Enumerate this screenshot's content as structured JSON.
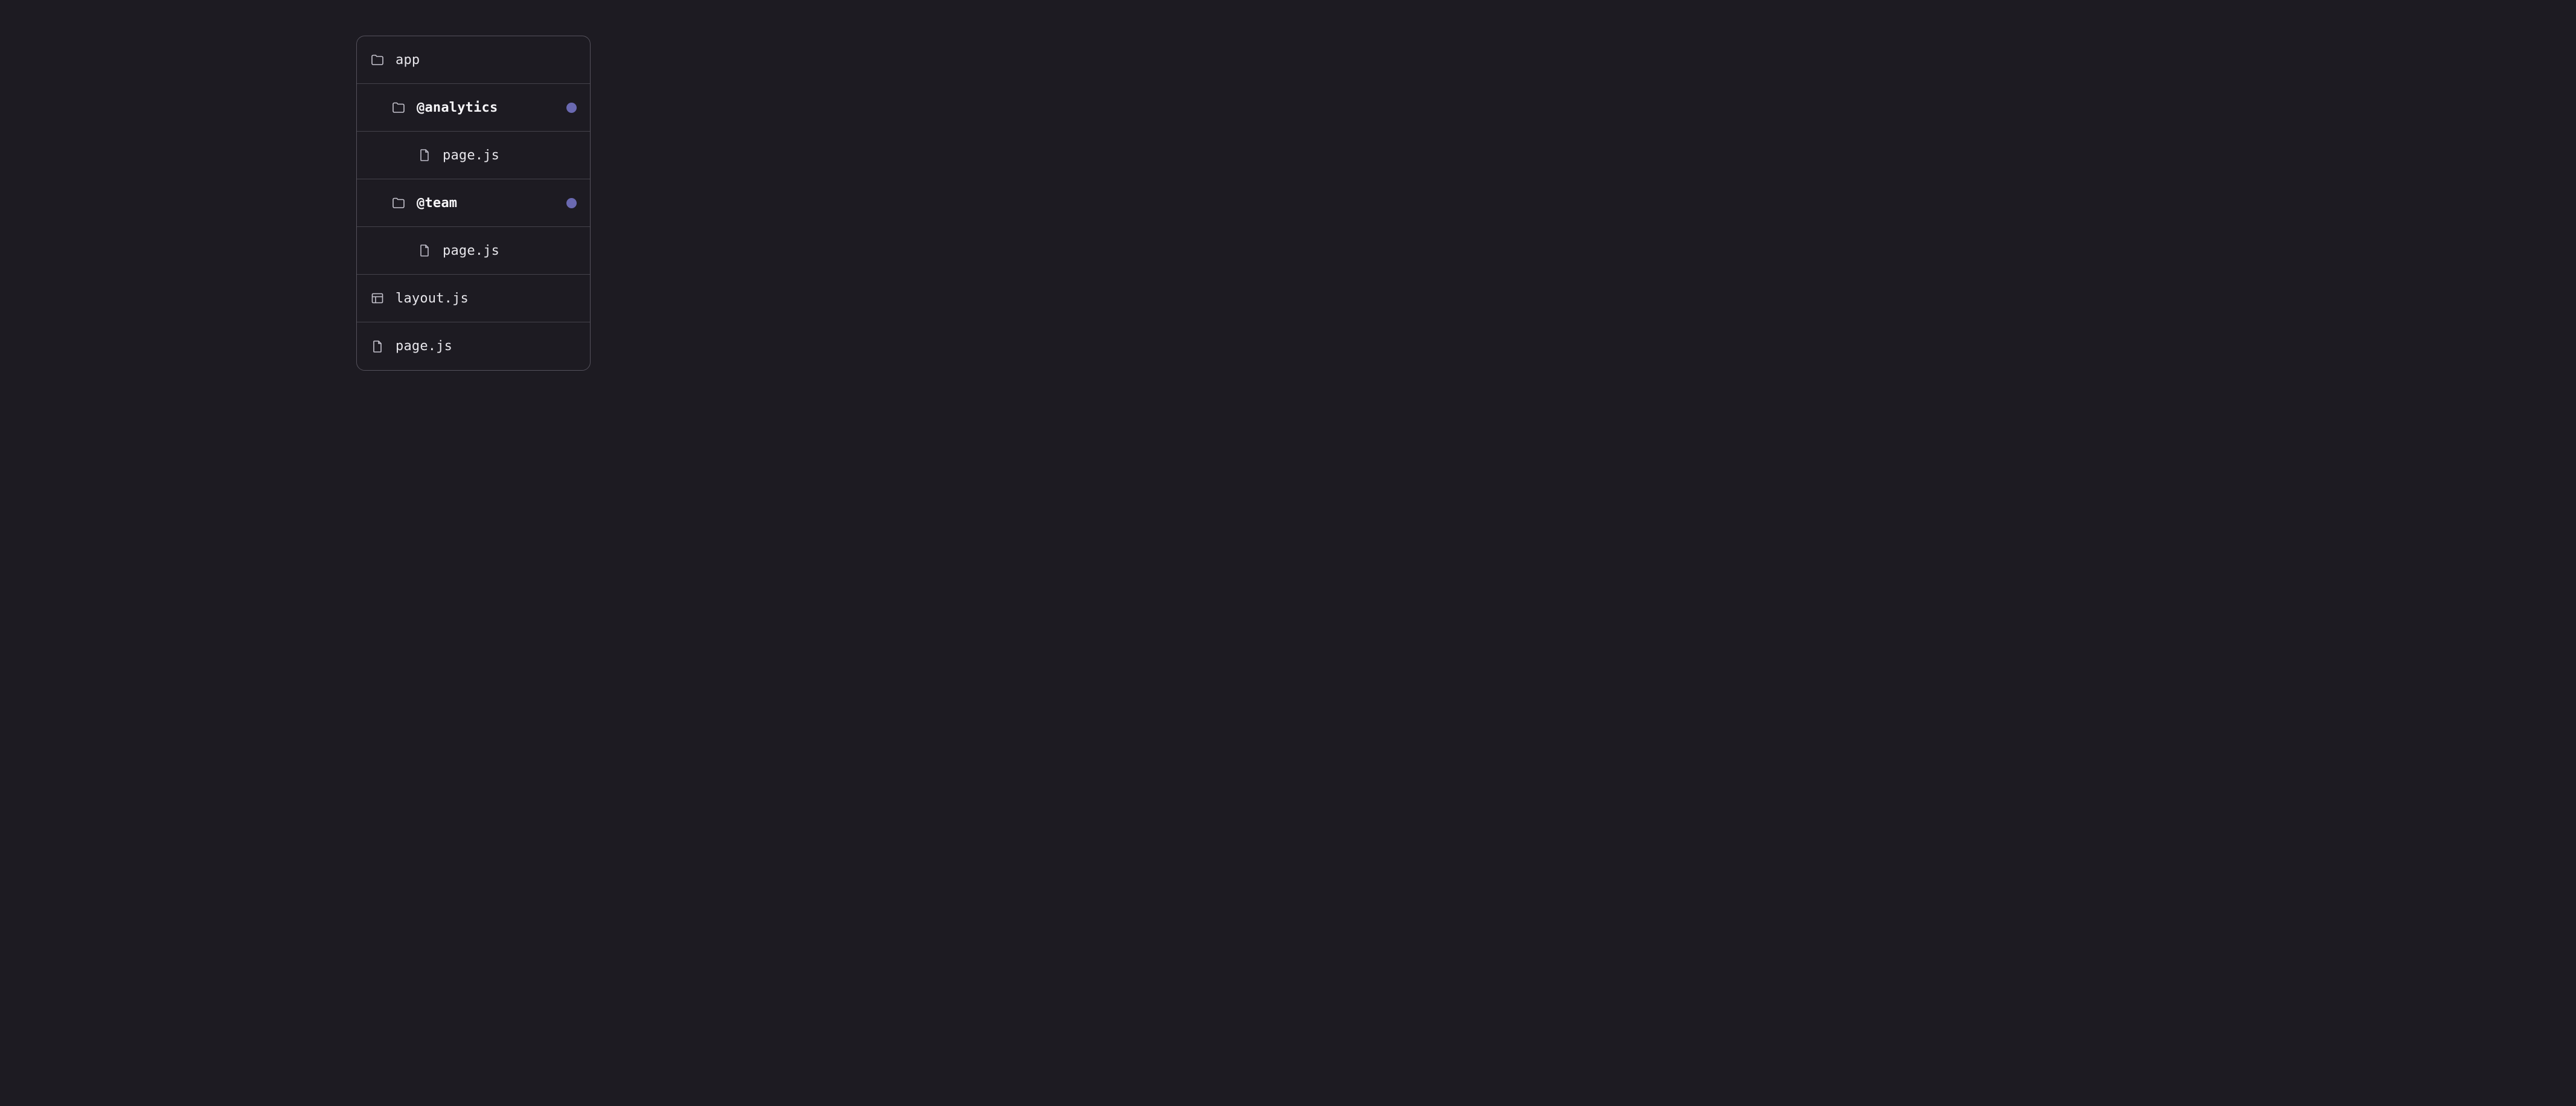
{
  "tree": {
    "items": [
      {
        "label": "app",
        "icon": "folder",
        "depth": 0,
        "bold": false,
        "dot": false
      },
      {
        "label": "@analytics",
        "icon": "folder",
        "depth": 1,
        "bold": true,
        "dot": true
      },
      {
        "label": "page.js",
        "icon": "file",
        "depth": 2,
        "bold": false,
        "dot": false
      },
      {
        "label": "@team",
        "icon": "folder",
        "depth": 1,
        "bold": true,
        "dot": true
      },
      {
        "label": "page.js",
        "icon": "file",
        "depth": 2,
        "bold": false,
        "dot": false
      },
      {
        "label": "layout.js",
        "icon": "layout",
        "depth": 0,
        "bold": false,
        "dot": false
      },
      {
        "label": "page.js",
        "icon": "file",
        "depth": 0,
        "bold": false,
        "dot": false
      }
    ]
  },
  "colors": {
    "dot": "#6a69b1",
    "bg": "#1d1b22",
    "border": "#55525c"
  }
}
